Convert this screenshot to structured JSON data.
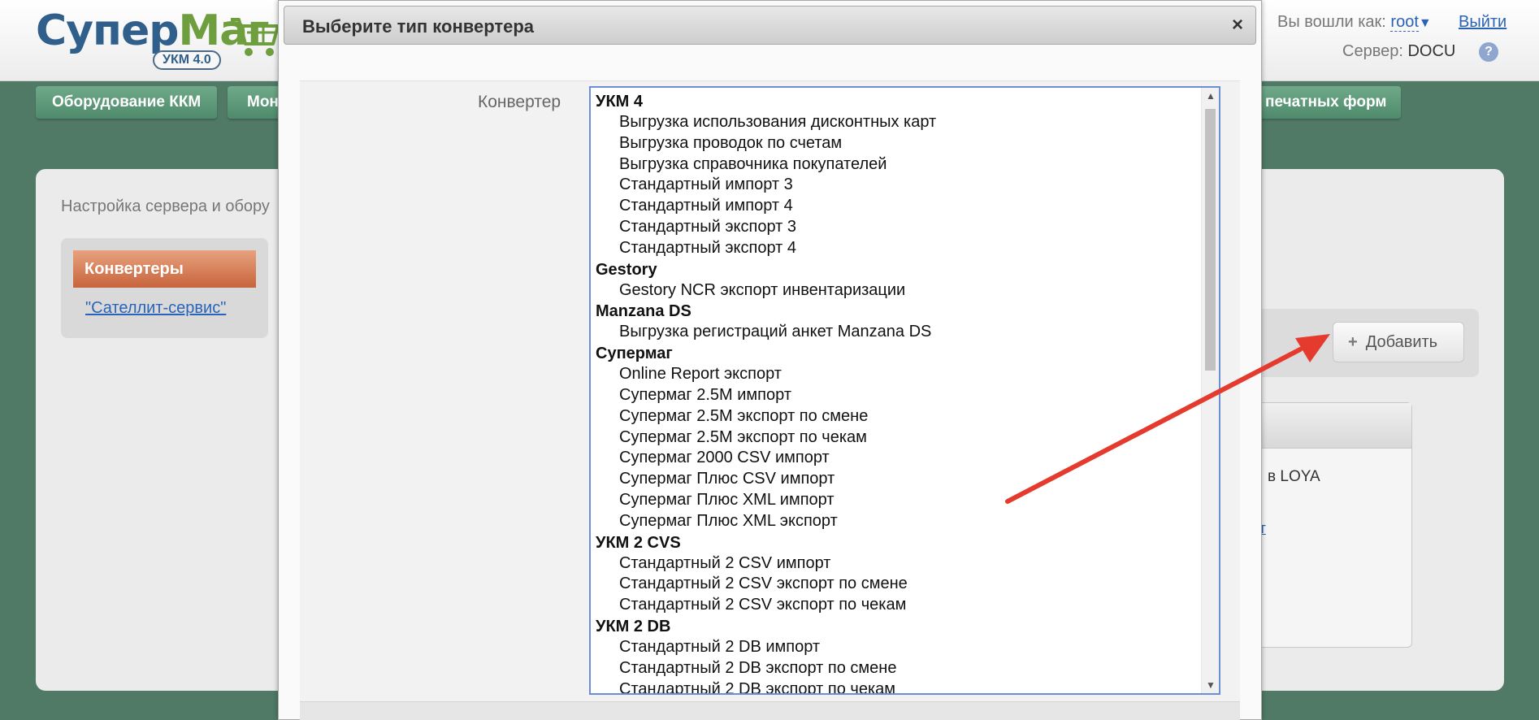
{
  "header": {
    "logo_part1": "Супер",
    "logo_part2": "Маг",
    "logo_badge": "УКМ 4.0",
    "logged_in_label": "Вы вошли как:",
    "user": "root",
    "user_arrow": "▼",
    "logout": "Выйти",
    "server_label": "Сервер:",
    "server_name": "DOCU",
    "help": "?"
  },
  "nav": {
    "items": [
      "Оборудование ККМ",
      "Мон",
      "печатных форм"
    ]
  },
  "page": {
    "breadcrumb": "Настройка сервера и обору",
    "sidebar_active": "Конвертеры",
    "sidebar_link": "\"Сателлит-сервис\"",
    "add_plus": "+",
    "add_button": "Добавить",
    "card_text": "в LOYA",
    "card_link": "от"
  },
  "modal": {
    "title": "Выберите тип конвертера",
    "close": "×",
    "field_label": "Конвертер",
    "scroll_up": "▲",
    "scroll_down": "▼",
    "groups": [
      {
        "label": "УКМ 4",
        "options": [
          "Выгрузка использования дисконтных карт",
          "Выгрузка проводок по счетам",
          "Выгрузка справочника покупателей",
          "Стандартный импорт 3",
          "Стандартный импорт 4",
          "Стандартный экспорт 3",
          "Стандартный экспорт 4"
        ]
      },
      {
        "label": "Gestory",
        "options": [
          "Gestory NCR экспорт инвентаризации"
        ]
      },
      {
        "label": "Manzana DS",
        "options": [
          "Выгрузка регистраций анкет Manzana DS"
        ]
      },
      {
        "label": "Супермаг",
        "options": [
          "Online Report экспорт",
          "Супермаг 2.5M импорт",
          "Супермаг 2.5M экспорт по смене",
          "Супермаг 2.5M экспорт по чекам",
          "Супермаг 2000 CSV импорт",
          "Супермаг Плюс CSV импорт",
          "Супермаг Плюс XML импорт",
          "Супермаг Плюс XML экспорт"
        ]
      },
      {
        "label": "УКМ 2 CVS",
        "options": [
          "Стандартный 2 CSV импорт",
          "Стандартный 2 CSV экспорт по смене",
          "Стандартный 2 CSV экспорт по чекам"
        ]
      },
      {
        "label": "УКМ 2 DB",
        "options": [
          "Стандартный 2 DB импорт",
          "Стандартный 2 DB экспорт по смене",
          "Стандартный 2 DB экспорт по чекам"
        ]
      }
    ]
  },
  "colors": {
    "background": "#507a66",
    "nav_button": "#5e9a7a",
    "sidebar_active": "#d97c52",
    "link": "#2a64b8",
    "listbox_border": "#6a8fd6",
    "annotation_arrow": "#e53b2f"
  }
}
